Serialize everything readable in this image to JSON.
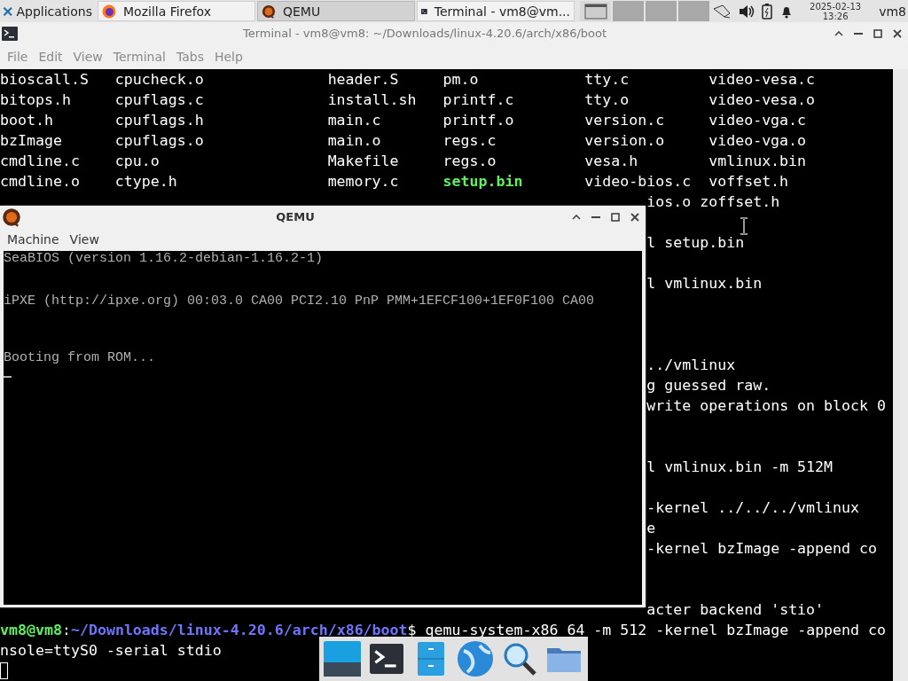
{
  "top_panel": {
    "applications_label": "Applications",
    "tasks": [
      {
        "label": "Mozilla Firefox",
        "kind": "firefox",
        "selected": false
      },
      {
        "label": "QEMU",
        "kind": "qemu",
        "selected": true
      },
      {
        "label": "Terminal - vm8@vm...",
        "kind": "terminal",
        "selected": false
      }
    ],
    "workspaces": [
      {
        "selected": true
      },
      {
        "selected": false
      },
      {
        "selected": false
      },
      {
        "selected": false
      }
    ],
    "date": "2025-02-13",
    "time": "13:26",
    "user": "vm8"
  },
  "terminal_window": {
    "title": "Terminal - vm8@vm8: ~/Downloads/linux-4.20.6/arch/x86/boot",
    "menu": [
      "File",
      "Edit",
      "View",
      "Terminal",
      "Tabs",
      "Help"
    ],
    "listing": [
      [
        {
          "name": "bioscall.S",
          "kind": "file"
        },
        {
          "name": "cpucheck.o",
          "kind": "file"
        },
        {
          "name": "header.S",
          "kind": "file"
        },
        {
          "name": "pm.o",
          "kind": "file"
        },
        {
          "name": "tty.c",
          "kind": "file"
        },
        {
          "name": "video-vesa.c",
          "kind": "file"
        }
      ],
      [
        {
          "name": "bitops.h",
          "kind": "file"
        },
        {
          "name": "cpuflags.c",
          "kind": "file"
        },
        {
          "name": "install.sh",
          "kind": "file"
        },
        {
          "name": "printf.c",
          "kind": "file"
        },
        {
          "name": "tty.o",
          "kind": "file"
        },
        {
          "name": "video-vesa.o",
          "kind": "file"
        }
      ],
      [
        {
          "name": "boot.h",
          "kind": "file"
        },
        {
          "name": "cpuflags.h",
          "kind": "file"
        },
        {
          "name": "main.c",
          "kind": "file"
        },
        {
          "name": "printf.o",
          "kind": "file"
        },
        {
          "name": "version.c",
          "kind": "file"
        },
        {
          "name": "video-vga.c",
          "kind": "file"
        }
      ],
      [
        {
          "name": "bzImage",
          "kind": "file"
        },
        {
          "name": "cpuflags.o",
          "kind": "file"
        },
        {
          "name": "main.o",
          "kind": "file"
        },
        {
          "name": "regs.c",
          "kind": "file"
        },
        {
          "name": "version.o",
          "kind": "file"
        },
        {
          "name": "video-vga.o",
          "kind": "file"
        }
      ],
      [
        {
          "name": "cmdline.c",
          "kind": "file"
        },
        {
          "name": "cpu.o",
          "kind": "file"
        },
        {
          "name": "Makefile",
          "kind": "file"
        },
        {
          "name": "regs.o",
          "kind": "file"
        },
        {
          "name": "vesa.h",
          "kind": "file"
        },
        {
          "name": "vmlinux.bin",
          "kind": "file"
        }
      ],
      [
        {
          "name": "cmdline.o",
          "kind": "file"
        },
        {
          "name": "ctype.h",
          "kind": "file"
        },
        {
          "name": "memory.c",
          "kind": "file"
        },
        {
          "name": "setup.bin",
          "kind": "executable"
        },
        {
          "name": "video-bios.c",
          "kind": "file"
        },
        {
          "name": "voffset.h",
          "kind": "file"
        }
      ]
    ],
    "lines": [
      {
        "kind": "partial",
        "text": "ios.o  zoffset.h"
      },
      {
        "kind": "blank"
      },
      {
        "kind": "partial",
        "text": "l setup.bin"
      },
      {
        "kind": "blank"
      },
      {
        "kind": "partial",
        "text": "l vmlinux.bin"
      },
      {
        "kind": "blank"
      },
      {
        "kind": "blank"
      },
      {
        "kind": "blank"
      },
      {
        "kind": "partial",
        "text": "../vmlinux"
      },
      {
        "kind": "partial",
        "text": "g guessed raw."
      },
      {
        "kind": "partial",
        "text": "write operations on block 0"
      },
      {
        "kind": "blank"
      },
      {
        "kind": "blank"
      },
      {
        "kind": "partial",
        "text": "l vmlinux.bin -m 512M"
      },
      {
        "kind": "blank"
      },
      {
        "kind": "partial",
        "text": " -kernel ../../../vmlinux"
      },
      {
        "kind": "partial",
        "text": "e"
      },
      {
        "kind": "partial",
        "text": " -kernel bzImage -append co"
      },
      {
        "kind": "blank"
      },
      {
        "kind": "blank"
      },
      {
        "kind": "partial",
        "text": "acter backend 'stio'"
      },
      {
        "kind": "prompt",
        "user": "vm8@vm8",
        "separator": ":",
        "path": "~/Downloads/linux-4.20.6/arch/x86/boot",
        "command": "$ qemu-system-x86_64 -m 512 -kernel bzImage -append co"
      },
      {
        "kind": "full",
        "text": "nsole=ttyS0 -serial stdio"
      },
      {
        "kind": "cursor"
      }
    ]
  },
  "qemu_window": {
    "title": "QEMU",
    "menu": [
      "Machine",
      "View"
    ],
    "screen_lines": [
      {
        "kind": "text",
        "text": "SeaBIOS (version 1.16.2-debian-1.16.2-1)"
      },
      {
        "kind": "blank"
      },
      {
        "kind": "blank"
      },
      {
        "kind": "text",
        "text": "iPXE (http://ipxe.org) 00:03.0 CA00 PCI2.10 PnP PMM+1EFCF100+1EF0F100 CA00"
      },
      {
        "kind": "blank"
      },
      {
        "kind": "blank"
      },
      {
        "kind": "blank"
      },
      {
        "kind": "text",
        "text": "Booting from ROM..."
      },
      {
        "kind": "cursor"
      }
    ]
  }
}
